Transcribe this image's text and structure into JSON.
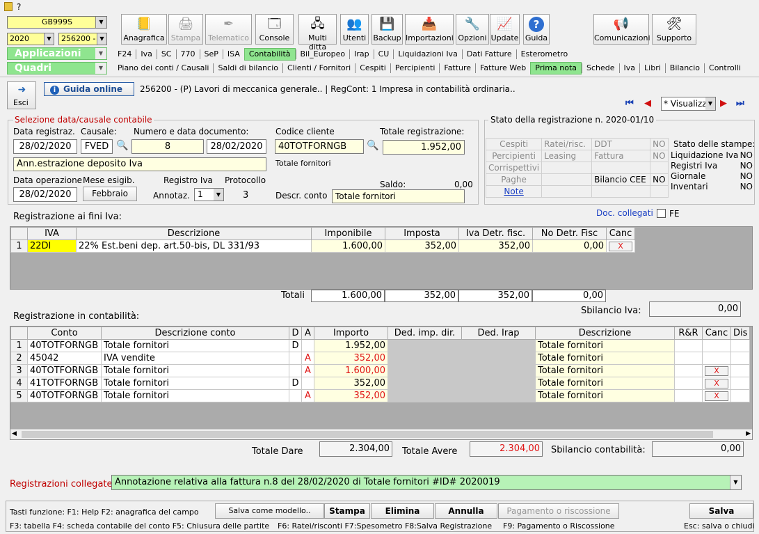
{
  "window": {
    "title": "?"
  },
  "company": {
    "code": "GB999S",
    "year": "2020",
    "client": "256200 -"
  },
  "toolbar": [
    {
      "label": "Anagrafica",
      "icon": "notebook-icon",
      "disabled": false
    },
    {
      "label": "Stampa",
      "icon": "printer-icon",
      "disabled": true
    },
    {
      "label": "Telematico",
      "icon": "telematic-icon",
      "disabled": true
    },
    {
      "label": "Console",
      "icon": "console-icon",
      "disabled": false
    },
    {
      "label": "Multi ditta",
      "icon": "network-icon",
      "disabled": false
    },
    {
      "label": "Utenti",
      "icon": "users-icon",
      "disabled": false
    },
    {
      "label": "Backup",
      "icon": "backup-icon",
      "disabled": false
    },
    {
      "label": "Importazioni",
      "icon": "import-icon",
      "disabled": false
    },
    {
      "label": "Opzioni",
      "icon": "tools-icon",
      "disabled": false
    },
    {
      "label": "Update",
      "icon": "monitor-icon",
      "disabled": false
    },
    {
      "label": "Guida",
      "icon": "help-icon",
      "disabled": false
    },
    {
      "label": "Comunicazioni",
      "icon": "communications-icon",
      "disabled": false
    },
    {
      "label": "Supporto",
      "icon": "support-icon",
      "disabled": false
    }
  ],
  "nav": {
    "applicazioni": "Applicazioni",
    "quadri": "Quadri",
    "row1": [
      "F24",
      "Iva",
      "SC",
      "770",
      "SeP",
      "ISA",
      "Contabilità",
      "Bil_Europeo",
      "Irap",
      "CU",
      "Liquidazioni Iva",
      "Dati Fatture",
      "Esterometro"
    ],
    "row1_active": "Contabilità",
    "row2": [
      "Piano dei conti / Causali",
      "Saldi di bilancio",
      "Clienti / Fornitori",
      "Cespiti",
      "Percipienti",
      "Fatture",
      "Fatture Web",
      "Prima nota",
      "Schede",
      "Iva",
      "Libri",
      "Bilancio",
      "Controlli"
    ],
    "row2_active": "Prima nota"
  },
  "header": {
    "esci": "Esci",
    "guida_online": "Guida online",
    "info": "256200 - (P) Lavori di meccanica generale.. | RegCont: 1 Impresa  in contabilità ordinaria..",
    "view_mode": "* Visualizz"
  },
  "selezione": {
    "title": "Selezione data/causale contabile",
    "data_reg_label": "Data registraz.",
    "data_reg": "28/02/2020",
    "causale_label": "Causale:",
    "causale": "FVED",
    "numdoc_label": "Numero e data documento:",
    "numdoc": "8",
    "datadoc": "28/02/2020",
    "descrizione": "Ann.estrazione deposito Iva",
    "data_op_label": "Data operazione",
    "data_op": "28/02/2020",
    "mese_label": "Mese esigib.",
    "mese": "Febbraio",
    "registro_label": "Registro Iva",
    "annotaz_label": "Annotaz.",
    "annotaz": "1",
    "protocollo_label": "Protocollo",
    "protocollo": "3",
    "codcliente_label": "Codice cliente",
    "codcliente": "40TOTFORNGB",
    "cliente_nome": "Totale fornitori",
    "totreg_label": "Totale registrazione:",
    "totreg": "1.952,00",
    "saldo_label": "Saldo:",
    "saldo": "0,00",
    "descrconto_label": "Descr. conto",
    "descrconto": "Totale fornitori"
  },
  "stato": {
    "title": "Stato della registrazione n. 2020-01/10",
    "grid": [
      [
        "Cespiti",
        "Ratei/risc.",
        "DDT",
        "NO"
      ],
      [
        "Percipienti",
        "Leasing",
        "Fattura",
        "NO"
      ],
      [
        "Corrispettivi",
        "",
        "",
        ""
      ],
      [
        "Paghe",
        "",
        "Bilancio CEE",
        "NO"
      ]
    ],
    "note": "Note",
    "stampe_title": "Stato delle stampe:",
    "stampe": [
      [
        "Liquidazione Iva",
        "NO"
      ],
      [
        "Registri Iva",
        "NO"
      ],
      [
        "Giornale",
        "NO"
      ],
      [
        "Inventari",
        "NO"
      ]
    ]
  },
  "iva": {
    "title": "Registrazione ai fini Iva:",
    "doc_collegati": "Doc. collegati",
    "fe": "FE",
    "headers": [
      "IVA",
      "Descrizione",
      "Imponibile",
      "Imposta",
      "Iva Detr. fisc.",
      "No Detr. Fisc",
      "Canc"
    ],
    "rows": [
      {
        "n": "1",
        "iva": "22DI",
        "desc": "22% Est.beni dep. art.50-bis, DL 331/93",
        "imponibile": "1.600,00",
        "imposta": "352,00",
        "detr": "352,00",
        "nodetr": "0,00"
      }
    ],
    "totali_label": "Totali",
    "totali": [
      "1.600,00",
      "352,00",
      "352,00",
      "0,00"
    ],
    "sbilancio_label": "Sbilancio Iva:",
    "sbilancio": "0,00",
    "canc": "X"
  },
  "contab": {
    "title": "Registrazione in contabilità:",
    "headers": [
      "Conto",
      "Descrizione conto",
      "D",
      "A",
      "Importo",
      "Ded. imp. dir.",
      "Ded. Irap",
      "Descrizione",
      "R&R",
      "Canc",
      "Dis"
    ],
    "rows": [
      {
        "n": "1",
        "conto": "40TOTFORNGB",
        "desc": "Totale fornitori",
        "d": "D",
        "a": "",
        "importo": "1.952,00",
        "descr": "Totale fornitori",
        "red": false,
        "canc": false
      },
      {
        "n": "2",
        "conto": "45042",
        "desc": "IVA vendite",
        "d": "",
        "a": "A",
        "importo": "352,00",
        "descr": "Totale fornitori",
        "red": true,
        "canc": false
      },
      {
        "n": "3",
        "conto": "40TOTFORNGB",
        "desc": "Totale fornitori",
        "d": "",
        "a": "A",
        "importo": "1.600,00",
        "descr": "Totale fornitori",
        "red": true,
        "canc": true
      },
      {
        "n": "4",
        "conto": "41TOTFORNGB",
        "desc": "Totale fornitori",
        "d": "D",
        "a": "",
        "importo": "352,00",
        "descr": "Totale fornitori",
        "red": false,
        "canc": true
      },
      {
        "n": "5",
        "conto": "40TOTFORNGB",
        "desc": "Totale fornitori",
        "d": "",
        "a": "A",
        "importo": "352,00",
        "descr": "Totale fornitori",
        "red": true,
        "canc": true
      }
    ],
    "tot_dare_label": "Totale Dare",
    "tot_dare": "2.304,00",
    "tot_avere_label": "Totale Avere",
    "tot_avere": "2.304,00",
    "sbil_label": "Sbilancio contabilità:",
    "sbil": "0,00"
  },
  "collegate": {
    "label": "Registrazioni collegate:",
    "value": "Annotazione relativa alla fattura n.8 del 28/02/2020 di Totale fornitori #ID# 2020019"
  },
  "footer": {
    "keys1": "Tasti funzione: F1: Help  F2: anagrafica del campo",
    "keys2": "F3: tabella   F4: scheda contabile del conto   F5: Chiusura delle partite",
    "keys3": "F6: Ratei/risconti   F7:Spesometro   F8:Salva Registrazione",
    "keys4": "F9: Pagamento o Riscossione",
    "keys5": "Esc: salva o chiudi",
    "salva_modello": "Salva come modello..",
    "stampa": "Stampa",
    "elimina": "Elimina",
    "annulla": "Annulla",
    "pagamento": "Pagamento o riscossione",
    "salva": "Salva"
  }
}
